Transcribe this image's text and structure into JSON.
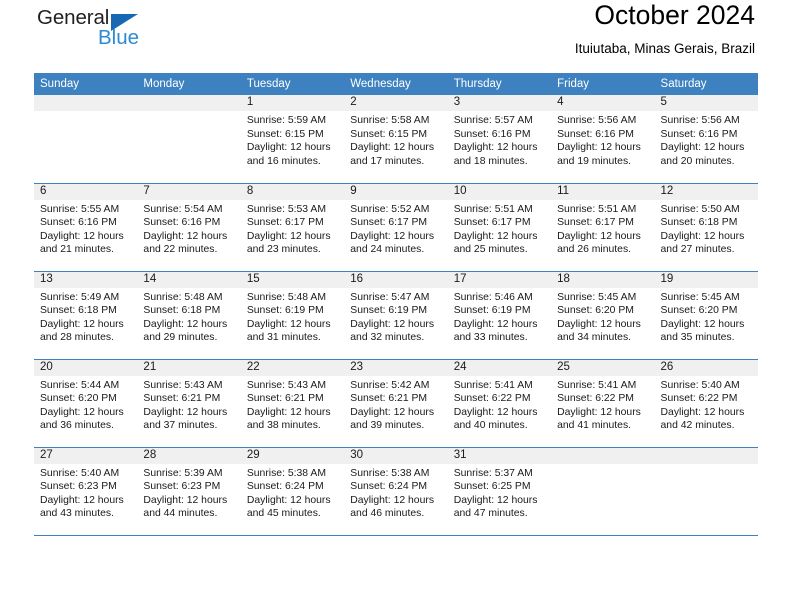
{
  "logo": {
    "word1": "General",
    "word2": "Blue",
    "triangle_icon": "blue-triangle-icon",
    "accent_dark": "#231f20",
    "accent_blue": "#2d8bd4",
    "triangle_blue": "#1668b3"
  },
  "header": {
    "title": "October 2024",
    "location": "Ituiutaba, Minas Gerais, Brazil"
  },
  "theme": {
    "header_bg": "#3d81c0",
    "header_text": "#ffffff",
    "daynum_band": "#f0f0f0",
    "cell_bg": "#ffffff",
    "row_rule": "#3d81c0"
  },
  "calendar": {
    "weekday_headers": [
      "Sunday",
      "Monday",
      "Tuesday",
      "Wednesday",
      "Thursday",
      "Friday",
      "Saturday"
    ],
    "labels": {
      "sunrise": "Sunrise:",
      "sunset": "Sunset:",
      "daylight": "Daylight:"
    },
    "weeks": [
      [
        {
          "day": "",
          "empty": true
        },
        {
          "day": "",
          "empty": true
        },
        {
          "day": "1",
          "sunrise": "Sunrise: 5:59 AM",
          "sunset": "Sunset: 6:15 PM",
          "daylight1": "Daylight: 12 hours",
          "daylight2": "and 16 minutes."
        },
        {
          "day": "2",
          "sunrise": "Sunrise: 5:58 AM",
          "sunset": "Sunset: 6:15 PM",
          "daylight1": "Daylight: 12 hours",
          "daylight2": "and 17 minutes."
        },
        {
          "day": "3",
          "sunrise": "Sunrise: 5:57 AM",
          "sunset": "Sunset: 6:16 PM",
          "daylight1": "Daylight: 12 hours",
          "daylight2": "and 18 minutes."
        },
        {
          "day": "4",
          "sunrise": "Sunrise: 5:56 AM",
          "sunset": "Sunset: 6:16 PM",
          "daylight1": "Daylight: 12 hours",
          "daylight2": "and 19 minutes."
        },
        {
          "day": "5",
          "sunrise": "Sunrise: 5:56 AM",
          "sunset": "Sunset: 6:16 PM",
          "daylight1": "Daylight: 12 hours",
          "daylight2": "and 20 minutes."
        }
      ],
      [
        {
          "day": "6",
          "sunrise": "Sunrise: 5:55 AM",
          "sunset": "Sunset: 6:16 PM",
          "daylight1": "Daylight: 12 hours",
          "daylight2": "and 21 minutes."
        },
        {
          "day": "7",
          "sunrise": "Sunrise: 5:54 AM",
          "sunset": "Sunset: 6:16 PM",
          "daylight1": "Daylight: 12 hours",
          "daylight2": "and 22 minutes."
        },
        {
          "day": "8",
          "sunrise": "Sunrise: 5:53 AM",
          "sunset": "Sunset: 6:17 PM",
          "daylight1": "Daylight: 12 hours",
          "daylight2": "and 23 minutes."
        },
        {
          "day": "9",
          "sunrise": "Sunrise: 5:52 AM",
          "sunset": "Sunset: 6:17 PM",
          "daylight1": "Daylight: 12 hours",
          "daylight2": "and 24 minutes."
        },
        {
          "day": "10",
          "sunrise": "Sunrise: 5:51 AM",
          "sunset": "Sunset: 6:17 PM",
          "daylight1": "Daylight: 12 hours",
          "daylight2": "and 25 minutes."
        },
        {
          "day": "11",
          "sunrise": "Sunrise: 5:51 AM",
          "sunset": "Sunset: 6:17 PM",
          "daylight1": "Daylight: 12 hours",
          "daylight2": "and 26 minutes."
        },
        {
          "day": "12",
          "sunrise": "Sunrise: 5:50 AM",
          "sunset": "Sunset: 6:18 PM",
          "daylight1": "Daylight: 12 hours",
          "daylight2": "and 27 minutes."
        }
      ],
      [
        {
          "day": "13",
          "sunrise": "Sunrise: 5:49 AM",
          "sunset": "Sunset: 6:18 PM",
          "daylight1": "Daylight: 12 hours",
          "daylight2": "and 28 minutes."
        },
        {
          "day": "14",
          "sunrise": "Sunrise: 5:48 AM",
          "sunset": "Sunset: 6:18 PM",
          "daylight1": "Daylight: 12 hours",
          "daylight2": "and 29 minutes."
        },
        {
          "day": "15",
          "sunrise": "Sunrise: 5:48 AM",
          "sunset": "Sunset: 6:19 PM",
          "daylight1": "Daylight: 12 hours",
          "daylight2": "and 31 minutes."
        },
        {
          "day": "16",
          "sunrise": "Sunrise: 5:47 AM",
          "sunset": "Sunset: 6:19 PM",
          "daylight1": "Daylight: 12 hours",
          "daylight2": "and 32 minutes."
        },
        {
          "day": "17",
          "sunrise": "Sunrise: 5:46 AM",
          "sunset": "Sunset: 6:19 PM",
          "daylight1": "Daylight: 12 hours",
          "daylight2": "and 33 minutes."
        },
        {
          "day": "18",
          "sunrise": "Sunrise: 5:45 AM",
          "sunset": "Sunset: 6:20 PM",
          "daylight1": "Daylight: 12 hours",
          "daylight2": "and 34 minutes."
        },
        {
          "day": "19",
          "sunrise": "Sunrise: 5:45 AM",
          "sunset": "Sunset: 6:20 PM",
          "daylight1": "Daylight: 12 hours",
          "daylight2": "and 35 minutes."
        }
      ],
      [
        {
          "day": "20",
          "sunrise": "Sunrise: 5:44 AM",
          "sunset": "Sunset: 6:20 PM",
          "daylight1": "Daylight: 12 hours",
          "daylight2": "and 36 minutes."
        },
        {
          "day": "21",
          "sunrise": "Sunrise: 5:43 AM",
          "sunset": "Sunset: 6:21 PM",
          "daylight1": "Daylight: 12 hours",
          "daylight2": "and 37 minutes."
        },
        {
          "day": "22",
          "sunrise": "Sunrise: 5:43 AM",
          "sunset": "Sunset: 6:21 PM",
          "daylight1": "Daylight: 12 hours",
          "daylight2": "and 38 minutes."
        },
        {
          "day": "23",
          "sunrise": "Sunrise: 5:42 AM",
          "sunset": "Sunset: 6:21 PM",
          "daylight1": "Daylight: 12 hours",
          "daylight2": "and 39 minutes."
        },
        {
          "day": "24",
          "sunrise": "Sunrise: 5:41 AM",
          "sunset": "Sunset: 6:22 PM",
          "daylight1": "Daylight: 12 hours",
          "daylight2": "and 40 minutes."
        },
        {
          "day": "25",
          "sunrise": "Sunrise: 5:41 AM",
          "sunset": "Sunset: 6:22 PM",
          "daylight1": "Daylight: 12 hours",
          "daylight2": "and 41 minutes."
        },
        {
          "day": "26",
          "sunrise": "Sunrise: 5:40 AM",
          "sunset": "Sunset: 6:22 PM",
          "daylight1": "Daylight: 12 hours",
          "daylight2": "and 42 minutes."
        }
      ],
      [
        {
          "day": "27",
          "sunrise": "Sunrise: 5:40 AM",
          "sunset": "Sunset: 6:23 PM",
          "daylight1": "Daylight: 12 hours",
          "daylight2": "and 43 minutes."
        },
        {
          "day": "28",
          "sunrise": "Sunrise: 5:39 AM",
          "sunset": "Sunset: 6:23 PM",
          "daylight1": "Daylight: 12 hours",
          "daylight2": "and 44 minutes."
        },
        {
          "day": "29",
          "sunrise": "Sunrise: 5:38 AM",
          "sunset": "Sunset: 6:24 PM",
          "daylight1": "Daylight: 12 hours",
          "daylight2": "and 45 minutes."
        },
        {
          "day": "30",
          "sunrise": "Sunrise: 5:38 AM",
          "sunset": "Sunset: 6:24 PM",
          "daylight1": "Daylight: 12 hours",
          "daylight2": "and 46 minutes."
        },
        {
          "day": "31",
          "sunrise": "Sunrise: 5:37 AM",
          "sunset": "Sunset: 6:25 PM",
          "daylight1": "Daylight: 12 hours",
          "daylight2": "and 47 minutes."
        },
        {
          "day": "",
          "empty": true
        },
        {
          "day": "",
          "empty": true
        }
      ]
    ]
  }
}
